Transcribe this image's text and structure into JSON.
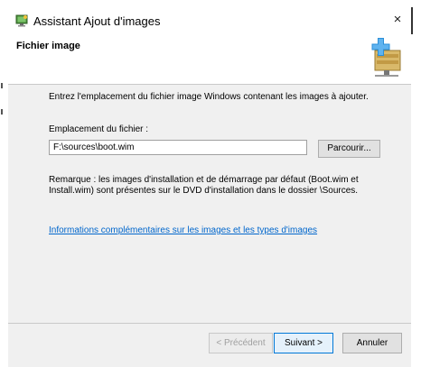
{
  "window": {
    "title": "Assistant Ajout d'images",
    "icons": {
      "app": "monitor-computer-icon",
      "close": "close-icon",
      "header": "server-add-icon"
    },
    "close_glyph": "×"
  },
  "header": {
    "title": "Fichier image"
  },
  "content": {
    "intro": "Entrez l'emplacement du fichier image Windows contenant les images à ajouter.",
    "location_label": "Emplacement du fichier :",
    "location_value": "F:\\sources\\boot.wim",
    "browse_label": "Parcourir...",
    "remark_line1": "Remarque : les images d'installation et de démarrage par défaut (Boot.wim et",
    "remark_line2": "Install.wim) sont présentes sur le DVD d'installation dans le dossier \\Sources.",
    "more_info_link": "Informations complémentaires sur les images et les types d'images"
  },
  "footer": {
    "previous_label": "< Précédent",
    "next_label": "Suivant >",
    "cancel_label": "Annuler"
  },
  "colors": {
    "link": "#0066cc",
    "panel": "#f0f0f0",
    "primary_border": "#0078d7"
  }
}
